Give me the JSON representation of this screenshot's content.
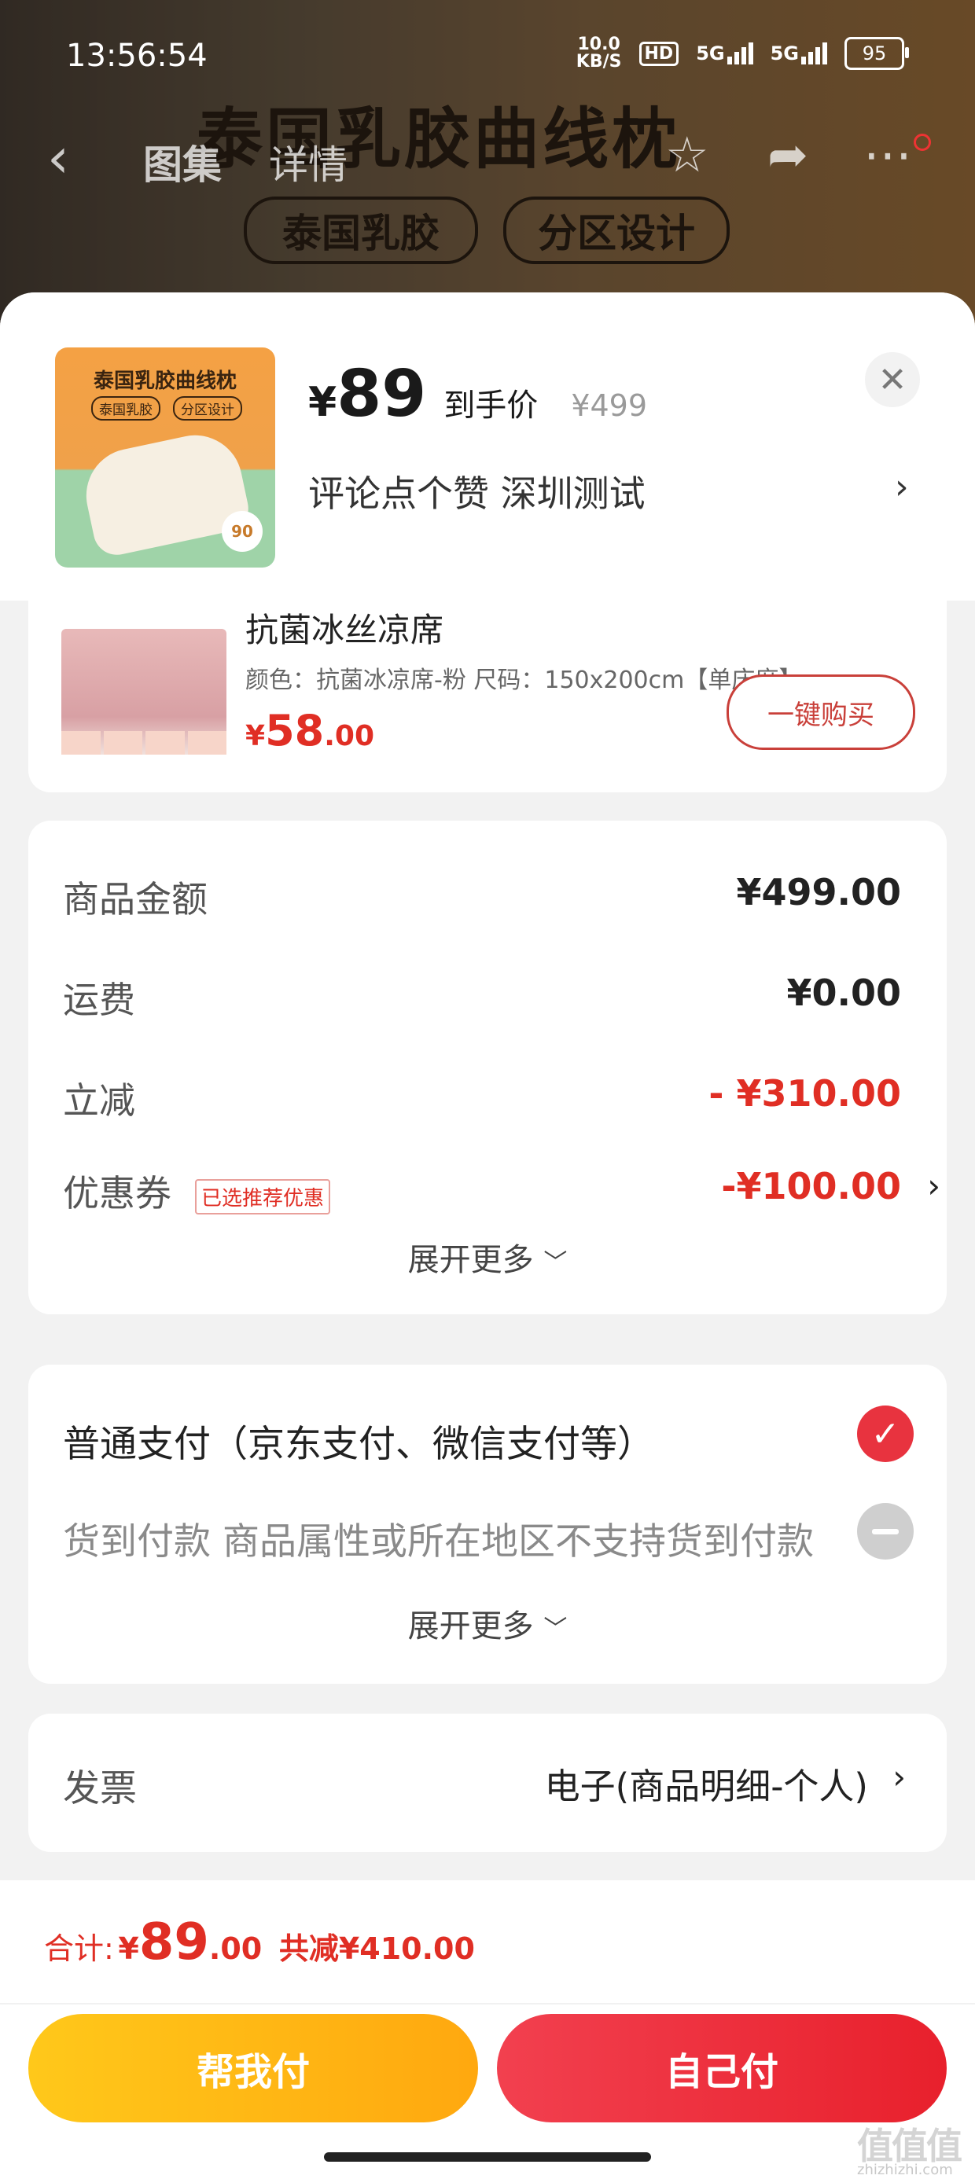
{
  "status_bar": {
    "time": "13:56:54",
    "net_speed_value": "10.0",
    "net_speed_unit": "KB/S",
    "hd_label": "HD",
    "signal1": "5G",
    "signal2": "5G",
    "battery": "95"
  },
  "background_page": {
    "banner_title": "泰国乳胶曲线枕",
    "banner_tag1": "泰国乳胶",
    "banner_tag2": "分区设计",
    "nav_tab_gallery": "图集",
    "nav_tab_detail": "详情"
  },
  "product": {
    "thumb_title": "泰国乳胶曲线枕",
    "thumb_tag1": "泰国乳胶",
    "thumb_tag2": "分区设计",
    "thumb_badge": "90",
    "price_symbol": "¥",
    "price": "89",
    "price_label": "到手价",
    "original_price": "¥499",
    "address_line": "评论点个赞  深圳测试"
  },
  "upsell": {
    "name": "抗菌冰丝凉席",
    "spec": "颜色：抗菌冰凉席-粉   尺码：150x200cm【单床席】",
    "price_symbol": "¥",
    "price_int": "58",
    "price_dec": ".00",
    "buy_button": "一键购买"
  },
  "fees": {
    "rows": [
      {
        "label": "商品金额",
        "value": "¥499.00"
      },
      {
        "label": "运费",
        "value": "¥0.00"
      },
      {
        "label": "立减",
        "value": "- ¥310.00"
      },
      {
        "label": "优惠券",
        "value": "-¥100.00"
      }
    ],
    "coupon_badge": "已选推荐优惠",
    "expand_more": "展开更多"
  },
  "payment": {
    "normal": "普通支付（京东支付、微信支付等）",
    "cod": "货到付款 商品属性或所在地区不支持货到付款",
    "expand_more": "展开更多"
  },
  "invoice": {
    "label": "发票",
    "value": "电子(商品明细-个人)"
  },
  "footer": {
    "total_label": "合计:",
    "total_symbol": "¥",
    "total_int": "89",
    "total_dec": ".00",
    "total_saved": "共减¥410.00",
    "help_pay": "帮我付",
    "self_pay": "自己付"
  },
  "watermark": {
    "text": "值值值",
    "sub": "zhizhizhi.com"
  },
  "colors": {
    "accent_red": "#e02e24",
    "pay_red": "#e8202c",
    "help_yellow": "#ffb414"
  }
}
